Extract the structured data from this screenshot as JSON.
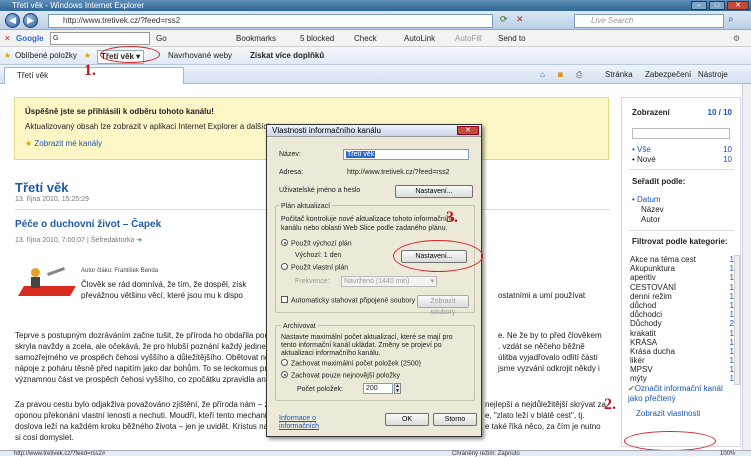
{
  "window": {
    "title": "Třetí věk - Windows Internet Explorer",
    "min": "–",
    "max": "□",
    "close": "✕"
  },
  "address": {
    "url": "http://www.tretivek.cz/?feed=rss2",
    "search_placeholder": "Live Search"
  },
  "google_bar": {
    "label": "Google",
    "search_label": "G",
    "go": "Go",
    "bookmarks": "Bookmarks",
    "blocked": "5 blocked",
    "check": "Check",
    "autolink": "AutoLink",
    "autofill": "AutoFill",
    "sendto": "Send to"
  },
  "favorites_bar": {
    "favorites": "Oblíbené položky",
    "feed": "Třetí věk",
    "suggested": "Navrhované weby",
    "addons": "Získat více doplňků"
  },
  "tab": {
    "title": "Třetí věk",
    "page": "Stránka",
    "security": "Zabezpečení",
    "tools": "Nástroje"
  },
  "notice": {
    "title": "Úspěšně jste se přihlásili k odběru tohoto kanálu!",
    "text": "Aktualizovaný obsah lze zobrazit v aplikaci Internet Explorer a dalších",
    "link": "Zobrazit mé kanály"
  },
  "feed": {
    "title": "Třetí věk",
    "date": "13. října 2010, 15:25:29"
  },
  "article": {
    "title": "Péče o duchovní život – Čapek",
    "meta": "13. října 2010, 7:00:07 | Šéfredaktorka",
    "author": "Autor čláku: František Benda",
    "p1": "Člověk se rád domnívá, že tím, že dospěl, získ",
    "p1b": "převážnou většinu věcí, které jsou mu k dispo",
    "p1r": "ostatními a umí používat",
    "p2a": "Teprve s postupným dozráváním začne tušit, že příroda ho obdařila pouz",
    "p2b": "skryla navždy a zcela, ale očekává, že pro hlubší poznání každý jedinec ta",
    "p2c": "samozřejmého ve prospěch čehosi vyššího a důležitějšího. Obětovat nez",
    "p2d": "nápoje z poháru těsně před napitím jako dar bohům. To se leckomus pr",
    "p2e": "významnou část ve prospěch čehosi vyššího, co zpočátku zpravidla ani d",
    "p2r1": "e. Ne že by to před člověkem",
    "p2r2": ". vzdát se něčeho běžně",
    "p2r3": "úlitba vyjadřovalo odlití části",
    "p2r4": "jsme vyzvání odkrojit někdy i",
    "p3a": "Za pravou cestu bylo odjakživa považováno zjištění, že příroda nám – zisk",
    "p3b": "oponou překonání vlastní lenosti a nechuti. Moudří, kteří tento mechanis",
    "p3c": "doslova leží na každém kroku běžného života – jen je uvidět. Kristus na t",
    "p3d": "si cosi domyslet.",
    "p3r1": "nejlepší a nejdůležitější skrývat za",
    "p3r2": "e, \"zlato leží v blátě cest\", tj.",
    "p3r3": "e také říká něco, za čím je nutno"
  },
  "sidebar": {
    "view": "Zobrazení",
    "count": "10 / 10",
    "all": "Vše",
    "all_n": "10",
    "new": "Nové",
    "new_n": "10",
    "sort": "Seřadit podle:",
    "sort_date": "Datum",
    "sort_name": "Název",
    "sort_author": "Autor",
    "filter": "Filtrovat podle kategorie:",
    "categories": [
      {
        "name": "Akce na téma cest",
        "n": "1"
      },
      {
        "name": "Akupunktura",
        "n": "1"
      },
      {
        "name": "aperitiv",
        "n": "1"
      },
      {
        "name": "CESTOVÁNÍ",
        "n": "1"
      },
      {
        "name": "denní režim",
        "n": "1"
      },
      {
        "name": "důchod",
        "n": "1"
      },
      {
        "name": "důchodci",
        "n": "1"
      },
      {
        "name": "Důchody",
        "n": "2"
      },
      {
        "name": "krakatit",
        "n": "1"
      },
      {
        "name": "KRÁSA",
        "n": "1"
      },
      {
        "name": "Krása ducha",
        "n": "1"
      },
      {
        "name": "likér",
        "n": "1"
      },
      {
        "name": "MPSV",
        "n": "1"
      },
      {
        "name": "mýty",
        "n": "1"
      }
    ],
    "mark_read": "Označit informační kanál jako přečtený",
    "show_props": "Zobrazit vlastnosti"
  },
  "dialog": {
    "title": "Vlastnosti informačního kanálu",
    "name_label": "Název:",
    "name_value": "Třetí věk",
    "address_label": "Adresa:",
    "address_value": "http://www.tretivek.cz/?feed=rss2",
    "userpass": "Uživatelské jméno a heslo",
    "settings": "Nastavení...",
    "plan_header": "Plán aktualizací",
    "plan_text": "Počítač kontroluje nové aktualizace tohoto informačního kanálu nebo oblasti Web Slice podle zadaného plánu.",
    "use_default": "Použít výchozí plán",
    "default_freq": "Výchozí: 1 den",
    "use_custom": "Použít vlastní plán",
    "frequency": "Frekvence:",
    "frequency_value": "Navrženo (1440 min)",
    "auto_download": "Automaticky stahovat připojené soubory",
    "show_files": "Zobrazit soubory",
    "archive_header": "Archivovat",
    "archive_text": "Nastavte maximální počet aktualizací, které se mají pro tento informační kanál ukládat. Změny se projeví po aktualizaci informačního kanálu.",
    "keep_max": "Zachovat maximální počet položek (2500)",
    "keep_newest": "Zachovat pouze nejnovější položky",
    "count_label": "Počet položek:",
    "count_value": "200",
    "info_link": "Informace o informačních",
    "ok": "OK",
    "cancel": "Storno"
  },
  "annotations": {
    "one": "1.",
    "two": "2.",
    "three": "3."
  },
  "status": {
    "url": "http://www.tretivek.cz/?feed=rss2#",
    "mode": "Chráněný režim: Zapnuto",
    "zoom": "100%"
  }
}
